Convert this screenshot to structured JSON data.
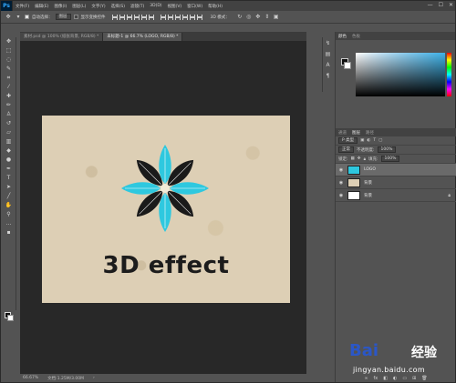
{
  "app": {
    "logo": "Ps",
    "menus": [
      "文件(F)",
      "编辑(E)",
      "图像(I)",
      "图层(L)",
      "文字(Y)",
      "选择(S)",
      "滤镜(T)",
      "3D(D)",
      "视图(V)",
      "窗口(W)",
      "帮助(H)"
    ],
    "window_controls": [
      "—",
      "☐",
      "✕"
    ]
  },
  "options_bar": {
    "auto_select_label": "自动选择：",
    "auto_select_value": "图层",
    "transform_label": "显示变换控件",
    "mode_label": "3D 模式："
  },
  "doc_tabs": [
    {
      "label": "素材.psd @ 100% (纸张背景, RGB/8) *",
      "active": false
    },
    {
      "label": "未标题-1 @ 66.7% (LOGO, RGB/8) *",
      "active": true
    }
  ],
  "canvas": {
    "headline": "3D effect",
    "logo_colors": {
      "petal": "#2ec8df",
      "leaf": "#1a1a1a",
      "center": "#f3ecd8"
    }
  },
  "status": {
    "zoom": "66.67%",
    "doc_size": "文档:1.25M/3.00M"
  },
  "panels": {
    "color_tabs": [
      "颜色",
      "色板"
    ],
    "layers_tabs": [
      "通道",
      "图层",
      "路径"
    ],
    "filter_label": "P 类型",
    "blend_mode": "正常",
    "opacity_label": "不透明度:",
    "opacity_value": "100%",
    "lock_label": "锁定:",
    "fill_label": "填充:",
    "fill_value": "100%",
    "layers": [
      {
        "name": "LOGO",
        "selected": true,
        "thumb": "logo"
      },
      {
        "name": "背景",
        "selected": false,
        "thumb": "paper"
      },
      {
        "name": "背景",
        "selected": false,
        "thumb": "white",
        "locked": true
      }
    ],
    "footer_icons": [
      "link-icon",
      "fx-icon",
      "mask-icon",
      "adjustment-icon",
      "folder-icon",
      "new-layer-icon",
      "trash-icon"
    ]
  },
  "watermark": {
    "brand": "Bai",
    "brand_suffix": "经验",
    "url": "jingyan.baidu.com"
  }
}
